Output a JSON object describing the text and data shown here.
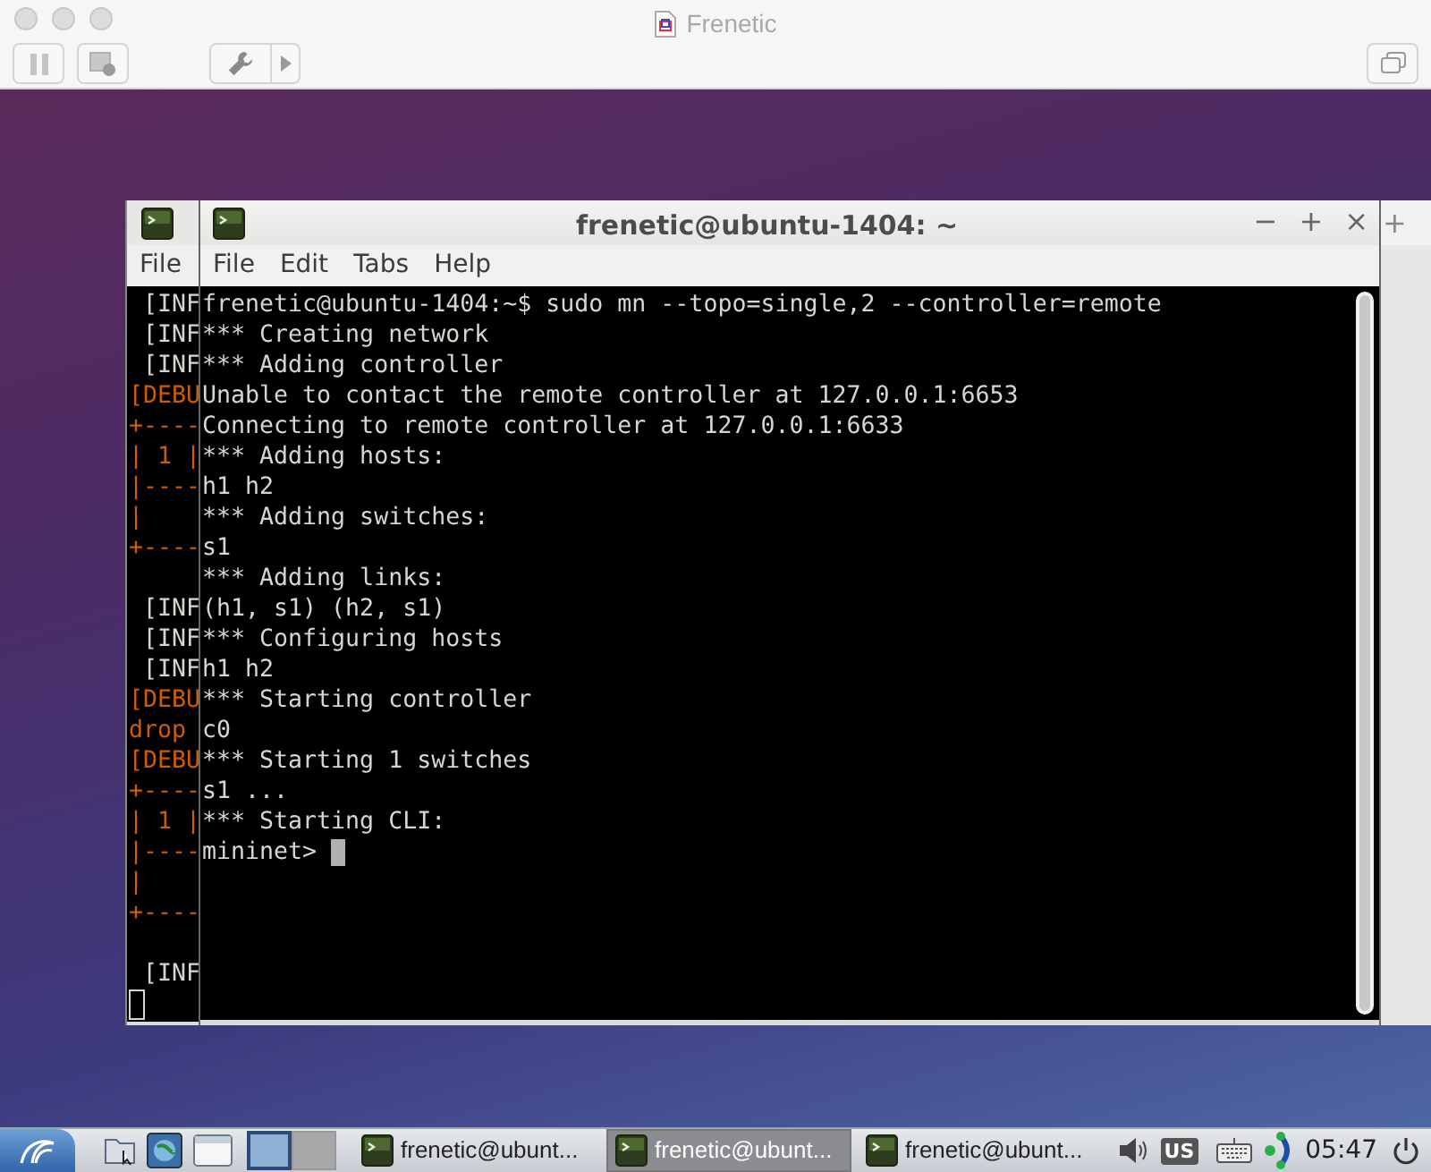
{
  "host_window": {
    "title": "Frenetic"
  },
  "terminals": [
    {
      "focused": false,
      "menu": [
        "File"
      ],
      "lines": [
        {
          "kind": "text",
          "text": " [INF",
          "color": "#d3d7cf"
        },
        {
          "kind": "text",
          "text": " [INF",
          "color": "#d3d7cf"
        },
        {
          "kind": "text",
          "text": " [INF",
          "color": "#d3d7cf"
        },
        {
          "kind": "text",
          "text": "[DEBU",
          "color": "#ce5c00"
        },
        {
          "kind": "text",
          "text": "+----",
          "color": "#ce5c00"
        },
        {
          "kind": "text",
          "text": "| 1 |",
          "color": "#ce5c00"
        },
        {
          "kind": "text",
          "text": "|----",
          "color": "#ce5c00"
        },
        {
          "kind": "text",
          "text": "|",
          "color": "#ce5c00"
        },
        {
          "kind": "text",
          "text": "+----",
          "color": "#ce5c00"
        },
        {
          "kind": "blank"
        },
        {
          "kind": "text",
          "text": " [INF",
          "color": "#d3d7cf"
        },
        {
          "kind": "text",
          "text": " [INF",
          "color": "#d3d7cf"
        },
        {
          "kind": "text",
          "text": " [INF",
          "color": "#d3d7cf"
        },
        {
          "kind": "text",
          "text": "[DEBU",
          "color": "#ce5c00"
        },
        {
          "kind": "text",
          "text": "drop",
          "color": "#ce5c00"
        },
        {
          "kind": "text",
          "text": "[DEBU",
          "color": "#ce5c00"
        },
        {
          "kind": "text",
          "text": "+----",
          "color": "#ce5c00"
        },
        {
          "kind": "text",
          "text": "| 1 |",
          "color": "#ce5c00"
        },
        {
          "kind": "text",
          "text": "|----",
          "color": "#ce5c00"
        },
        {
          "kind": "text",
          "text": "|",
          "color": "#ce5c00"
        },
        {
          "kind": "text",
          "text": "+----",
          "color": "#ce5c00"
        },
        {
          "kind": "blank"
        },
        {
          "kind": "text",
          "text": " [INF",
          "color": "#d3d7cf"
        },
        {
          "kind": "cursor"
        }
      ]
    },
    {
      "focused": true,
      "title": "frenetic@ubuntu-1404: ~",
      "controls": [
        "−",
        "+",
        "×"
      ],
      "menu": [
        "File",
        "Edit",
        "Tabs",
        "Help"
      ],
      "lines": [
        {
          "kind": "text",
          "text": "frenetic@ubuntu-1404:~$ sudo mn --topo=single,2 --controller=remote"
        },
        {
          "kind": "text",
          "text": "*** Creating network"
        },
        {
          "kind": "text",
          "text": "*** Adding controller"
        },
        {
          "kind": "text",
          "text": "Unable to contact the remote controller at 127.0.0.1:6653"
        },
        {
          "kind": "text",
          "text": "Connecting to remote controller at 127.0.0.1:6633"
        },
        {
          "kind": "text",
          "text": "*** Adding hosts:"
        },
        {
          "kind": "text",
          "text": "h1 h2"
        },
        {
          "kind": "text",
          "text": "*** Adding switches:"
        },
        {
          "kind": "text",
          "text": "s1"
        },
        {
          "kind": "text",
          "text": "*** Adding links:"
        },
        {
          "kind": "text",
          "text": "(h1, s1) (h2, s1)"
        },
        {
          "kind": "text",
          "text": "*** Configuring hosts"
        },
        {
          "kind": "text",
          "text": "h1 h2"
        },
        {
          "kind": "text",
          "text": "*** Starting controller"
        },
        {
          "kind": "text",
          "text": "c0"
        },
        {
          "kind": "text",
          "text": "*** Starting 1 switches"
        },
        {
          "kind": "text",
          "text": "s1 ..."
        },
        {
          "kind": "text",
          "text": "*** Starting CLI:"
        },
        {
          "kind": "prompt",
          "text": "mininet>"
        }
      ]
    },
    {
      "focused": false,
      "controls": [
        "+"
      ]
    }
  ],
  "taskbar": {
    "workspaces": [
      {
        "selected": true
      },
      {
        "selected": false
      }
    ],
    "tasks": [
      {
        "label": "frenetic@ubunt...",
        "selected": false
      },
      {
        "label": "frenetic@ubunt...",
        "selected": true
      },
      {
        "label": "frenetic@ubunt...",
        "selected": false
      }
    ],
    "keyboard_layout": "US",
    "clock": "05:47"
  }
}
